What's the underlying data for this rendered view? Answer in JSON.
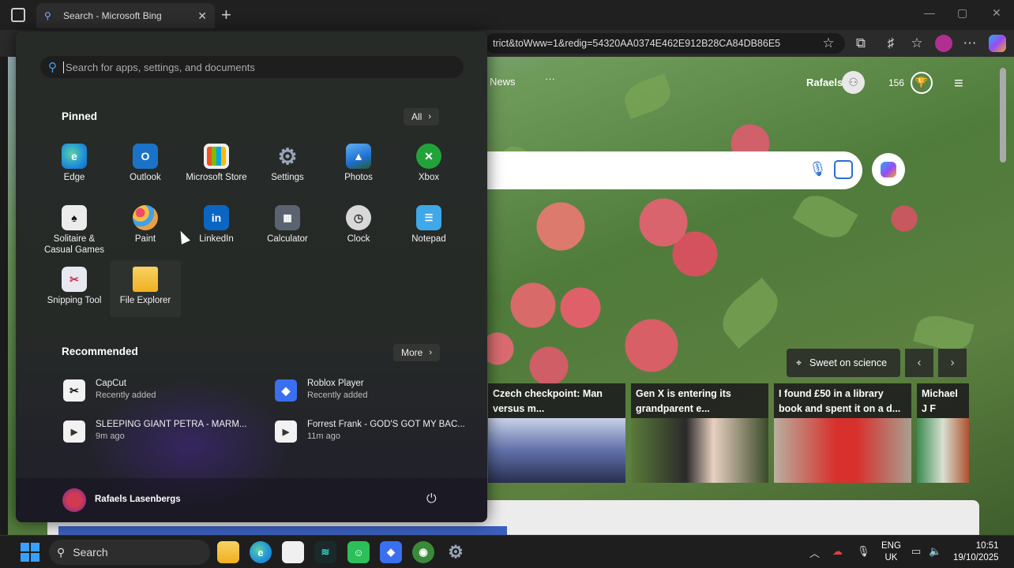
{
  "browser": {
    "tab_title": "Search - Microsoft Bing",
    "tab_close": "✕",
    "new_tab": "+",
    "url": "trict&toWww=1&redig=54320AA0374E462E912B28CA84DB86E5",
    "window_controls": [
      "—",
      "▢",
      "✕"
    ]
  },
  "bing": {
    "nav_news": "News",
    "nav_more": "···",
    "user_name": "Rafaels",
    "points": "156",
    "location_label": "Sweet on science",
    "news": [
      {
        "title": "Czech checkpoint: Man versus m..."
      },
      {
        "title": "Gen X is entering its grandparent e..."
      },
      {
        "title": "I found £50 in a library book and spent it on a d..."
      },
      {
        "title": "Michael J F 'created fri"
      }
    ]
  },
  "start_menu": {
    "search_placeholder": "Search for apps, settings, and documents",
    "pinned_title": "Pinned",
    "all_label": "All",
    "pinned": [
      {
        "label": "Edge",
        "icon": "edge-icon",
        "color": "#1f8fdc"
      },
      {
        "label": "Outlook",
        "icon": "outlook-icon",
        "color": "#1b73c8"
      },
      {
        "label": "Microsoft Store",
        "icon": "store-icon",
        "color": "#f0f0f0"
      },
      {
        "label": "Settings",
        "icon": "gear-icon",
        "color": "#8a97a8"
      },
      {
        "label": "Photos",
        "icon": "photos-icon",
        "color": "#2f86e0"
      },
      {
        "label": "Xbox",
        "icon": "xbox-icon",
        "color": "#22a33a"
      },
      {
        "label": "Solitaire & Casual Games",
        "icon": "cards-icon",
        "color": "#ececec"
      },
      {
        "label": "Paint",
        "icon": "palette-icon",
        "color": "#e8a040"
      },
      {
        "label": "LinkedIn",
        "icon": "linkedin-icon",
        "color": "#0a66c2"
      },
      {
        "label": "Calculator",
        "icon": "calculator-icon",
        "color": "#5a6470"
      },
      {
        "label": "Clock",
        "icon": "clock-icon",
        "color": "#d8d8d8"
      },
      {
        "label": "Notepad",
        "icon": "notepad-icon",
        "color": "#3fa8e8"
      },
      {
        "label": "Snipping Tool",
        "icon": "scissors-icon",
        "color": "#e8e8f0"
      },
      {
        "label": "File Explorer",
        "icon": "folder-icon",
        "color": "#f3c43a"
      }
    ],
    "recommended_title": "Recommended",
    "more_label": "More",
    "recommended": [
      {
        "title": "CapCut",
        "sub": "Recently added",
        "icon": "capcut-icon"
      },
      {
        "title": "Roblox Player",
        "sub": "Recently added",
        "icon": "roblox-icon"
      },
      {
        "title": "SLEEPING GIANT   PETRA - MARM...",
        "sub": "9m ago",
        "icon": "video-file-icon"
      },
      {
        "title": "Forrest Frank - GOD'S GOT MY BAC...",
        "sub": "11m ago",
        "icon": "video-file-icon"
      }
    ],
    "user_name": "Rafaels Lasenbergs"
  },
  "taskbar": {
    "search_label": "Search",
    "language_line1": "ENG",
    "language_line2": "UK",
    "time": "10:51",
    "date": "19/10/2025"
  }
}
